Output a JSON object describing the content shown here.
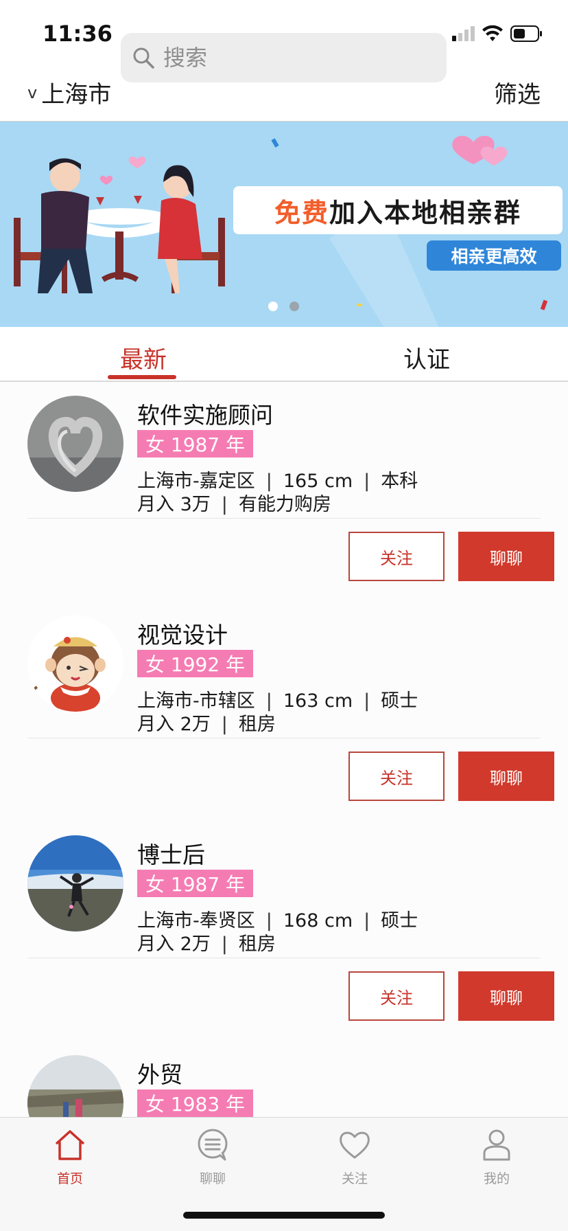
{
  "status_bar": {
    "time": "11:36"
  },
  "search": {
    "placeholder": "搜索"
  },
  "header": {
    "city": "上海市",
    "city_chevron": "v",
    "filter_label": "筛选"
  },
  "banner": {
    "headline_highlight": "免费",
    "headline_rest": "加入本地相亲群",
    "subtitle": "相亲更高效",
    "dots": [
      true,
      false
    ]
  },
  "tabs": [
    {
      "label": "最新",
      "active": true
    },
    {
      "label": "认证",
      "active": false
    }
  ],
  "profiles": [
    {
      "title": "软件实施顾问",
      "gender_year": "女 1987 年",
      "location": "上海市-嘉定区",
      "height": "165 cm",
      "education": "本科",
      "income": "月入 3万",
      "housing": "有能力购房",
      "follow_label": "关注",
      "chat_label": "聊聊"
    },
    {
      "title": "视觉设计",
      "gender_year": "女 1992 年",
      "location": "上海市-市辖区",
      "height": "163 cm",
      "education": "硕士",
      "income": "月入 2万",
      "housing": "租房",
      "follow_label": "关注",
      "chat_label": "聊聊"
    },
    {
      "title": "博士后",
      "gender_year": "女 1987 年",
      "location": "上海市-奉贤区",
      "height": "168 cm",
      "education": "硕士",
      "income": "月入 2万",
      "housing": "租房",
      "follow_label": "关注",
      "chat_label": "聊聊"
    },
    {
      "title": "外贸",
      "gender_year": "女 1983 年"
    }
  ],
  "separator": "|",
  "bottom_nav": [
    {
      "label": "首页",
      "icon": "home-icon",
      "active": true
    },
    {
      "label": "聊聊",
      "icon": "chat-bubble-icon",
      "active": false
    },
    {
      "label": "关注",
      "icon": "heart-icon",
      "active": false
    },
    {
      "label": "我的",
      "icon": "person-icon",
      "active": false
    }
  ],
  "colors": {
    "accent": "#c8322a",
    "chat_button": "#d0392b",
    "badge": "#f57cb3",
    "banner_bg": "#a8d8f4",
    "banner_sub_bg": "#2f86d9"
  }
}
